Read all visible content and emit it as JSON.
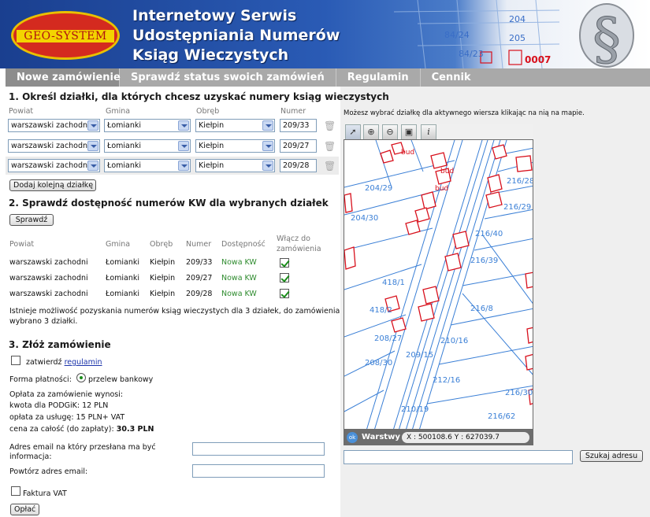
{
  "header": {
    "logo_text": "GEO-SYSTEM",
    "title_lines": [
      "Internetowy Serwis",
      "Udostępniania Numerów",
      "Ksiąg Wieczystych"
    ],
    "map_labels": [
      "204",
      "205",
      "84/24",
      "84/23",
      "0007"
    ]
  },
  "nav": {
    "items": [
      {
        "label": "Nowe zamówienie",
        "active": true
      },
      {
        "label": "Sprawdź status swoich zamówień",
        "active": false
      },
      {
        "label": "Regulamin",
        "active": false
      },
      {
        "label": "Cennik",
        "active": false
      }
    ]
  },
  "step1": {
    "heading": "1. Określ działki, dla których chcesz uzyskać numery ksiąg wieczystych",
    "col_powiat": "Powiat",
    "col_gmina": "Gmina",
    "col_obreb": "Obręb",
    "col_numer": "Numer",
    "rows": [
      {
        "powiat": "warszawski zachodni",
        "gmina": "Łomianki",
        "obreb": "Kiełpin",
        "numer": "209/33"
      },
      {
        "powiat": "warszawski zachodni",
        "gmina": "Łomianki",
        "obreb": "Kiełpin",
        "numer": "209/27"
      },
      {
        "powiat": "warszawski zachodni",
        "gmina": "Łomianki",
        "obreb": "Kiełpin",
        "numer": "209/28"
      }
    ],
    "add_button": "Dodaj kolejną działkę"
  },
  "step2": {
    "heading": "2. Sprawdź dostępność numerów KW dla wybranych działek",
    "check_button": "Sprawdź",
    "col_powiat": "Powiat",
    "col_gmina": "Gmina",
    "col_obreb": "Obręb",
    "col_numer": "Numer",
    "col_dostepnosc": "Dostępność",
    "col_wlacz_1": "Włącz do",
    "col_wlacz_2": "zamówienia",
    "rows": [
      {
        "powiat": "warszawski zachodni",
        "gmina": "Łomianki",
        "obreb": "Kiełpin",
        "numer": "209/33",
        "status": "Nowa KW",
        "checked": true
      },
      {
        "powiat": "warszawski zachodni",
        "gmina": "Łomianki",
        "obreb": "Kiełpin",
        "numer": "209/27",
        "status": "Nowa KW",
        "checked": true
      },
      {
        "powiat": "warszawski zachodni",
        "gmina": "Łomianki",
        "obreb": "Kiełpin",
        "numer": "209/28",
        "status": "Nowa KW",
        "checked": true
      }
    ],
    "info_line1": "Istnieje możliwość pozyskania numerów ksiąg wieczystych dla 3 działek, do zamówienia",
    "info_line2": "wybrano 3 działki."
  },
  "step3": {
    "heading": "3. Złóż zamówienie",
    "confirm_text": "zatwierdź",
    "regulamin_link": "regulamin",
    "payment_label": "Forma płatności:",
    "payment_option": "przelew bankowy",
    "fee_header": "Opłata za zamówienie wynosi:",
    "fee_podgik": "kwota dla PODGiK: 12 PLN",
    "fee_service": "opłata za usługę: 15 PLN+ VAT",
    "total_label": "cena za całość (do zapłaty):",
    "total_value": "30.3 PLN",
    "email_label_1": "Adres email na który przesłana ma być",
    "email_label_2": "informacja:",
    "email_repeat_label": "Powtórz adres email:",
    "email_value": "",
    "email_repeat_value": "",
    "vat_label": "Faktura VAT",
    "pay_button": "Opłać"
  },
  "map": {
    "hint": "Możesz wybrać działkę dla aktywnego wiersza klikając na nią na mapie.",
    "tools": [
      "pointer-icon",
      "zoom-in-icon",
      "zoom-out-icon",
      "full-extent-icon",
      "info-icon"
    ],
    "tool_glyphs": [
      "➚",
      "⊕",
      "⊖",
      "▣",
      "i"
    ],
    "layers_label": "Warstwy",
    "coords": "X : 500108.6   Y : 627039.7",
    "ok_icon": "ok",
    "search_value": "",
    "search_button": "Szukaj adresu",
    "labels": [
      "204/29",
      "204/30",
      "216/28",
      "216/29",
      "216/40",
      "216/39",
      "418/1",
      "418/2",
      "208/27",
      "210/16",
      "208/30",
      "209/15",
      "216/8",
      "212/16",
      "216/30",
      "210/19",
      "216/62",
      "bud",
      "bud",
      "bud"
    ],
    "colors": {
      "parcel": "#3a7fd6",
      "building": "#d8101c",
      "label": "#3a7fd6"
    }
  }
}
